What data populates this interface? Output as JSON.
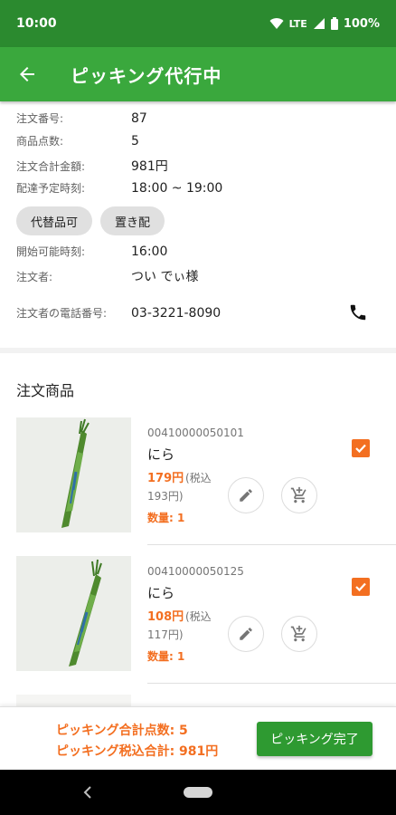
{
  "status_bar": {
    "time": "10:00",
    "network": "LTE",
    "battery": "100%"
  },
  "app_bar": {
    "title": "ピッキング代行中"
  },
  "order": {
    "rows": [
      {
        "label": "注文番号:",
        "value": "87"
      },
      {
        "label": "商品点数:",
        "value": "5"
      },
      {
        "label": "注文合計金額:",
        "value": "981円"
      },
      {
        "label": "配達予定時刻:",
        "value": "18:00 ~ 19:00"
      }
    ],
    "chips": [
      "代替品可",
      "置き配"
    ],
    "rows2": [
      {
        "label": "開始可能時刻:",
        "value": "16:00"
      },
      {
        "label": "注文者:",
        "value": "つい でぃ様"
      },
      {
        "label": "注文者の電話番号:",
        "value": "03-3221-8090"
      }
    ]
  },
  "section_title": "注文商品",
  "products": [
    {
      "code": "00410000050101",
      "name": "にら",
      "price": "179円",
      "tax_a": "(税込",
      "tax_b": "193円)",
      "qty": "数量: 1",
      "checked": true
    },
    {
      "code": "00410000050125",
      "name": "にら",
      "price": "108円",
      "tax_a": "(税込",
      "tax_b": "117円)",
      "qty": "数量: 1",
      "checked": true
    }
  ],
  "footer": {
    "total_points": "ピッキング合計点数: 5",
    "total_price": "ピッキング税込合計: 981円",
    "complete_label": "ピッキング完了"
  },
  "colors": {
    "primary": "#3aa83d",
    "status": "#2b8a2f",
    "accent": "#f36f21",
    "button": "#2e9a31"
  }
}
